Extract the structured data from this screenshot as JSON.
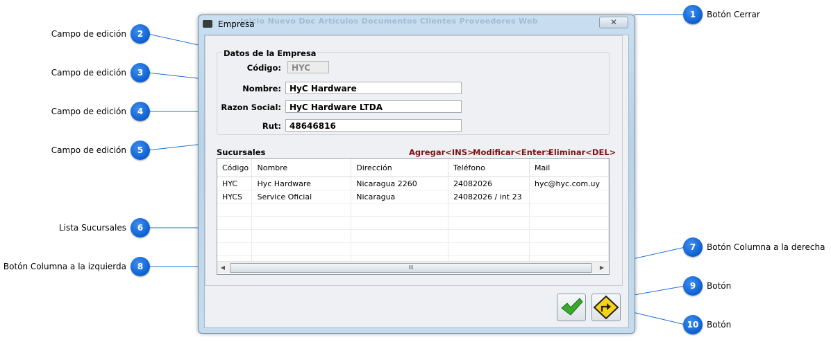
{
  "window": {
    "title": "Empresa",
    "menu_ghost": "Inicio   Nuevo Doc    Artículos    Documentos    Clientes    Proveedores    Web",
    "close_glyph": "✕"
  },
  "datos": {
    "group_title": "Datos de la Empresa",
    "codigo_label": "Código:",
    "codigo_value": "HYC",
    "nombre_label": "Nombre:",
    "nombre_value": "HyC Hardware",
    "razon_label": "Razon Social:",
    "razon_value": "HyC Hardware LTDA",
    "rut_label": "Rut:",
    "rut_value": "48646816"
  },
  "sucursales": {
    "title": "Sucursales",
    "actions": {
      "agregar": "Agregar<INS>",
      "modificar": "Modificar<Enter>",
      "eliminar": "Eliminar<DEL>"
    },
    "columns": [
      "Código",
      "Nombre",
      "Dirección",
      "Teléfono",
      "Mail"
    ],
    "rows": [
      [
        "HYC",
        "Hyc Hardware",
        "Nicaragua 2260",
        "24082026",
        "hyc@hyc.com.uy"
      ],
      [
        "HYCS",
        "Service Oficial",
        "Nicaragua",
        "24082026 / int  23",
        ""
      ]
    ],
    "scroll_left": "◀",
    "scroll_right": "▶",
    "scroll_grip": "III"
  },
  "callouts": [
    {
      "num": "1",
      "text": "Botón Cerrar"
    },
    {
      "num": "2",
      "text": "Campo de edición"
    },
    {
      "num": "3",
      "text": "Campo de edición"
    },
    {
      "num": "4",
      "text": "Campo de edición"
    },
    {
      "num": "5",
      "text": "Campo de edición"
    },
    {
      "num": "6",
      "text": "Lista Sucursales"
    },
    {
      "num": "7",
      "text": "Botón Columna a la derecha"
    },
    {
      "num": "8",
      "text": "Botón Columna a la izquierda"
    },
    {
      "num": "9",
      "text": "Botón"
    },
    {
      "num": "10",
      "text": "Botón"
    }
  ],
  "icons": {
    "accept": "check-icon",
    "exit": "exit-arrow-icon",
    "window": "window-app-icon"
  },
  "colors": {
    "action_text": "#7a1111",
    "badge": "#0b5fd0",
    "callout_line": "#1a6fd8"
  }
}
